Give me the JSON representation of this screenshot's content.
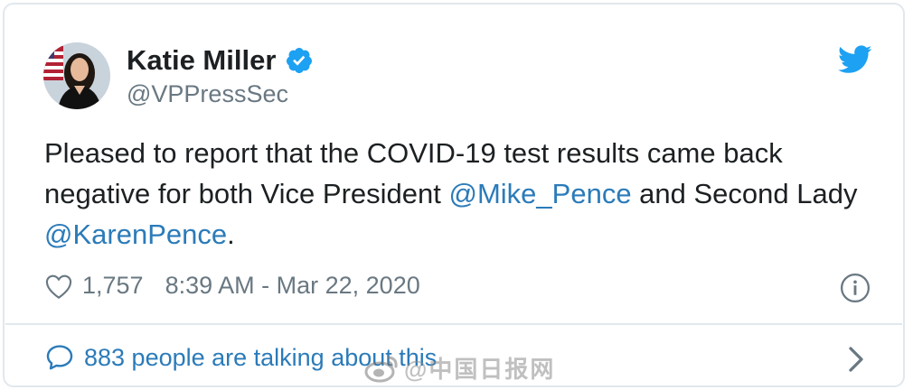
{
  "tweet": {
    "author_name": "Katie Miller",
    "author_handle": "@VPPressSec",
    "text_part1": "Pleased to report that the COVID-19 test results came back negative for both Vice President ",
    "mention1": "@Mike_Pence",
    "text_part2": " and Second Lady ",
    "mention2": "@KarenPence",
    "text_part3": ".",
    "likes": "1,757",
    "timestamp": "8:39 AM - Mar 22, 2020",
    "talking_text": "883 people are talking about this"
  },
  "watermark": {
    "text": "@中国日报网"
  },
  "colors": {
    "link": "#2b7bb9",
    "twitter_blue": "#1da1f2",
    "muted": "#697882",
    "text": "#1c2022",
    "border": "#e1e8ed"
  },
  "icons": {
    "verified": "verified-badge-icon",
    "twitter": "twitter-bird-icon",
    "like": "heart-icon",
    "info": "info-icon",
    "reply": "speech-bubble-icon",
    "more": "chevron-right-icon",
    "weibo": "weibo-logo-icon"
  }
}
